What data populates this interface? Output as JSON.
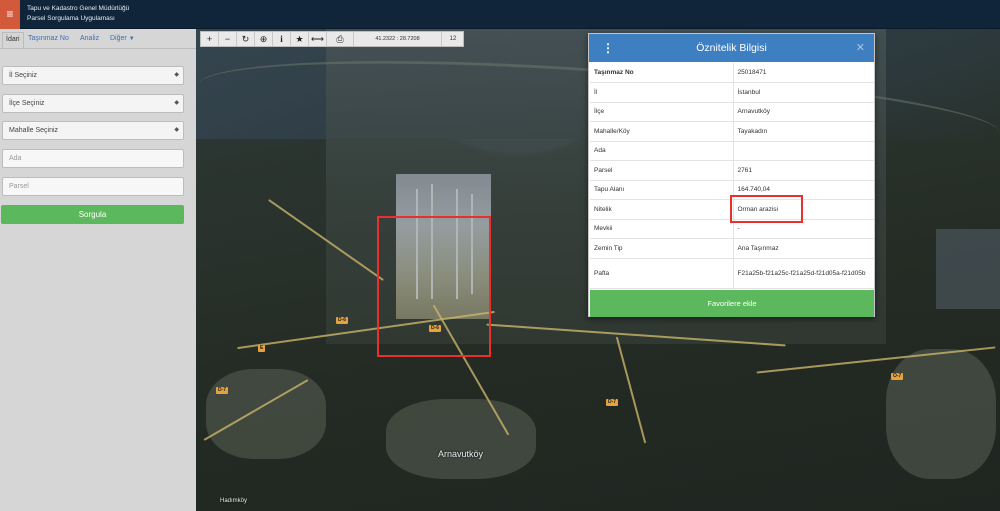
{
  "header": {
    "menu_icon": "menu-icon",
    "title_line1": "Tapu ve Kadastro Genel Müdürlüğü",
    "title_line2": "Parsel Sorgulama Uygulaması"
  },
  "sidebar": {
    "tabs": [
      {
        "label": "İdari"
      },
      {
        "label": "Taşınmaz No"
      },
      {
        "label": "Analiz"
      },
      {
        "label": "Diğer"
      }
    ],
    "fields": {
      "il": "İl Seçiniz",
      "ilce": "İlçe Seçiniz",
      "mahalle": "Mahalle Seçiniz",
      "ada_placeholder": "Ada",
      "parsel_placeholder": "Parsel"
    },
    "query_button": "Sorgula"
  },
  "toolbar": {
    "zoom_in": "+",
    "zoom_out": "−",
    "refresh": "↻",
    "locate": "⊕",
    "info": "i",
    "favorite": "★",
    "measure": "⟷",
    "print": "⎙",
    "coordinates": "41.2322 : 28.7208",
    "zoom_level": "12"
  },
  "map": {
    "labels": {
      "arnavutkoy": "Arnavutköy",
      "haciman": "Hadımköy"
    },
    "road_shields": [
      "D-6",
      "D-6",
      "D-7",
      "D-7",
      "O-7",
      "E"
    ]
  },
  "modal": {
    "title": "Öznitelik Bilgisi",
    "rows": [
      {
        "key": "Taşınmaz No",
        "value": "25018471"
      },
      {
        "key": "İl",
        "value": "İstanbul"
      },
      {
        "key": "İlçe",
        "value": "Arnavutköy"
      },
      {
        "key": "Mahalle/Köy",
        "value": "Tayakadın"
      },
      {
        "key": "Ada",
        "value": ""
      },
      {
        "key": "Parsel",
        "value": "2761"
      },
      {
        "key": "Tapu Alanı",
        "value": "164.740,04"
      },
      {
        "key": "Nitelik",
        "value": "Orman arazisi"
      },
      {
        "key": "Mevkii",
        "value": "-"
      },
      {
        "key": "Zemin Tip",
        "value": "Ana Taşınmaz"
      },
      {
        "key": "Pafta",
        "value": "F21a25b-f21a25c-f21a25d-f21d05a-f21d05b"
      }
    ],
    "favorite_button": "Favorilere ekle"
  }
}
